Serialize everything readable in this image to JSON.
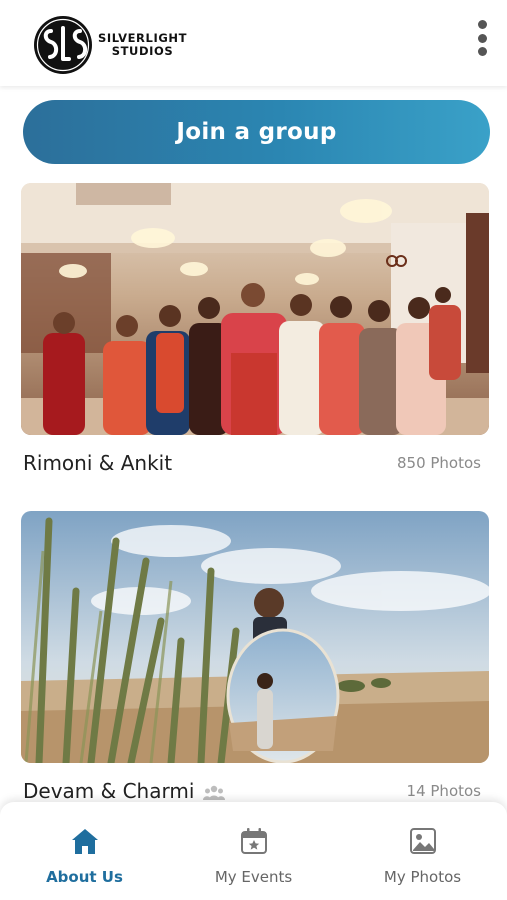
{
  "brand": {
    "monogram": "SLS",
    "line1": "SILVERLIGHT",
    "line2": "STUDIOS"
  },
  "header": {
    "menu_icon": "kebab-menu-icon"
  },
  "join_button": {
    "label": "Join a group"
  },
  "events": [
    {
      "title": "Rimoni & Ankit",
      "photo_count": "850 Photos",
      "photo": "wedding-group-photo"
    },
    {
      "title": "Devam & Charmi",
      "photo_count": "14 Photos",
      "photo": "desert-couple-photo",
      "badge_icon": "group-people-icon"
    }
  ],
  "bottom_nav": {
    "items": [
      {
        "label": "About Us",
        "icon": "home-icon",
        "active": true
      },
      {
        "label": "My Events",
        "icon": "calendar-star-icon",
        "active": false
      },
      {
        "label": "My Photos",
        "icon": "gallery-icon",
        "active": false
      }
    ]
  },
  "colors": {
    "accent": "#1f6e9e",
    "join_gradient_start": "#2c6f9a",
    "join_gradient_end": "#3aa1c8",
    "muted_text": "#8a8a8a"
  }
}
